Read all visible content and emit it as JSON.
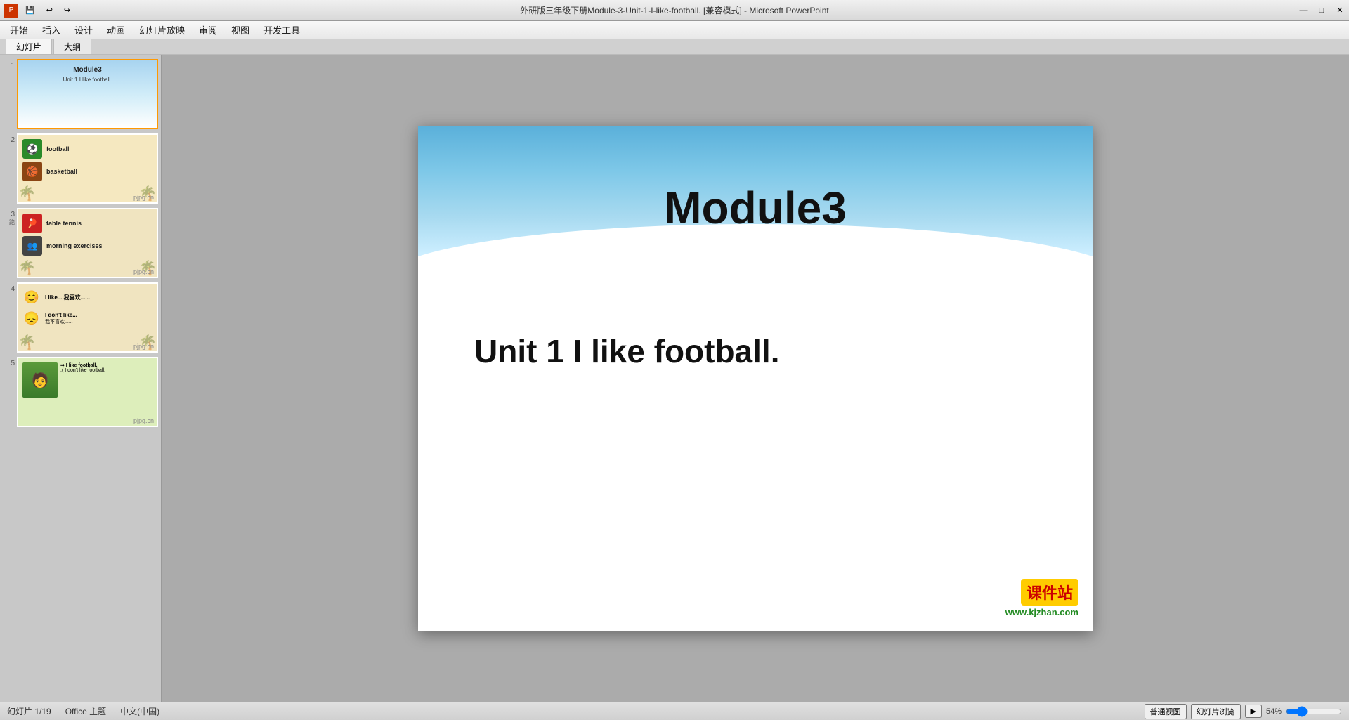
{
  "titlebar": {
    "title": "外研版三年级下册Module-3-Unit-1-I-like-football. [兼容模式] - Microsoft PowerPoint",
    "app_label": "P",
    "minimize": "—",
    "maximize": "□",
    "close": "✕"
  },
  "menubar": {
    "items": [
      "开始",
      "插入",
      "设计",
      "动画",
      "幻灯片放映",
      "审阅",
      "视图",
      "开发工具"
    ]
  },
  "panel_tabs": {
    "slides_label": "幻灯片",
    "outline_label": "大纲"
  },
  "slides": [
    {
      "number": "1",
      "title": "Module3",
      "subtitle": "Unit 1 I like football."
    },
    {
      "number": "2",
      "items": [
        {
          "icon": "⚽",
          "label": "football",
          "icon_bg": "#2a7a2a"
        },
        {
          "icon": "🏀",
          "label": "basketball",
          "icon_bg": "#8b4513"
        }
      ]
    },
    {
      "number": "3",
      "items": [
        {
          "icon": "🏓",
          "label": "table tennis",
          "icon_bg": "#cc2222"
        },
        {
          "icon": "👥",
          "label": "morning exercises",
          "icon_bg": "#555"
        }
      ]
    },
    {
      "number": "4",
      "items": [
        {
          "icon": "😊",
          "label1": "I like...",
          "label2": "我喜欢......"
        },
        {
          "icon": "😞",
          "label1": "I don't like...",
          "label2": "我不喜欢......"
        }
      ]
    },
    {
      "number": "5",
      "lines": [
        "⇒ I like football.",
        ";(I don't like football."
      ]
    }
  ],
  "main_slide": {
    "title": "Module3",
    "subtitle": "Unit 1 I like football."
  },
  "statusbar": {
    "slide_info": "幻灯片 1/19",
    "theme": "Office 主题",
    "language": "中文(中国)"
  },
  "watermark": {
    "top": "课件站",
    "bottom": "www.kjzhan.com"
  }
}
